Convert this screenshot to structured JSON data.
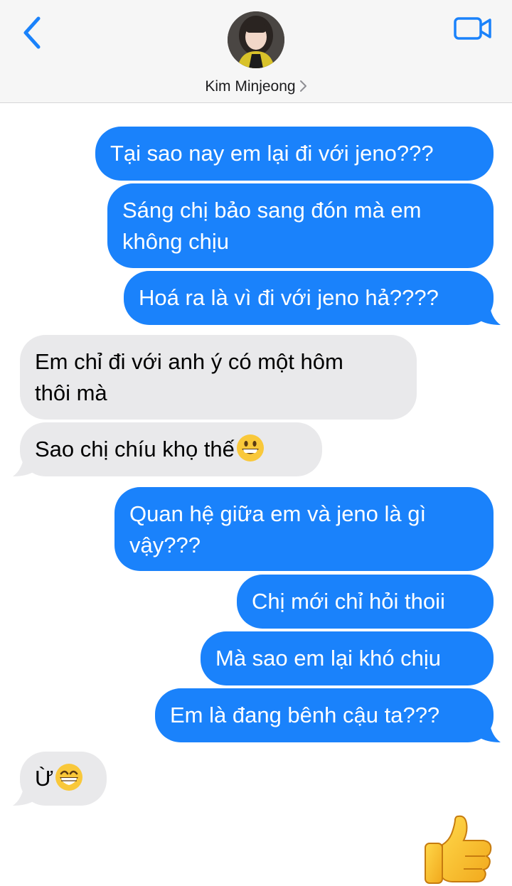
{
  "header": {
    "contact_name": "Kim Minjeong",
    "back_icon": "chevron-left-icon",
    "video_icon": "video-camera-icon",
    "accent_color": "#1a82fb"
  },
  "messages": [
    {
      "side": "out",
      "lines": [
        "Tại sao nay em lại đi với jeno???"
      ]
    },
    {
      "side": "out",
      "lines": [
        "Sáng chị bảo sang đón mà em",
        "không chịu"
      ]
    },
    {
      "side": "out",
      "lines": [
        "Hoá ra là vì đi với jeno hả????"
      ]
    },
    {
      "side": "in",
      "lines": [
        "Em chỉ đi với anh ý có một hôm",
        "thôi mà"
      ]
    },
    {
      "side": "in",
      "lines": [
        "Sao chị chíu khọ thế"
      ],
      "emoji": "grinning-face"
    },
    {
      "side": "out",
      "lines": [
        "Quan hệ giữa em và jeno là gì",
        "vậy???"
      ]
    },
    {
      "side": "out",
      "lines": [
        "Chị mới chỉ hỏi thoii"
      ]
    },
    {
      "side": "out",
      "lines": [
        "Mà sao em lại khó chịu"
      ]
    },
    {
      "side": "out",
      "lines": [
        "Em là đang bênh cậu ta???"
      ]
    },
    {
      "side": "in",
      "lines": [
        "Ừ"
      ],
      "emoji": "beaming-face"
    },
    {
      "side": "out",
      "sticker": "thumbs-up"
    }
  ]
}
